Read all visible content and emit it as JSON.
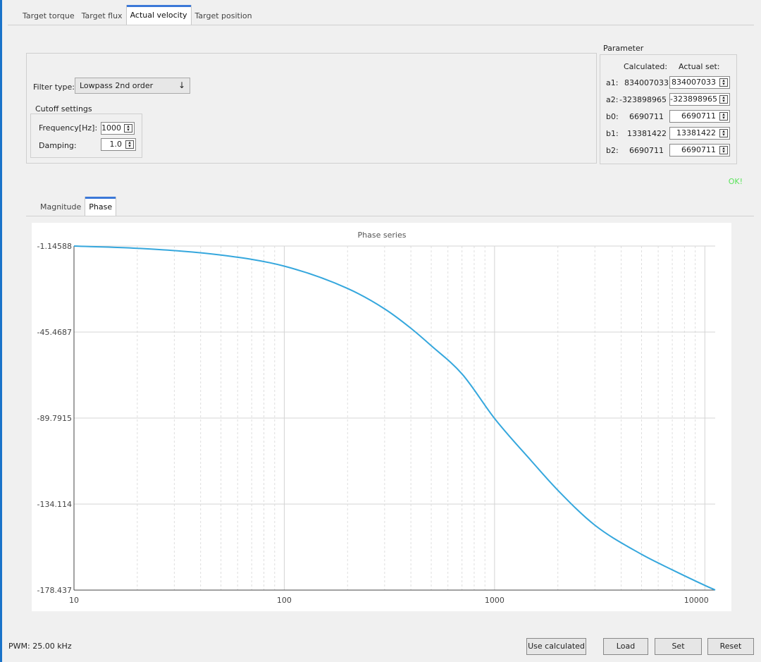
{
  "tabs": [
    "Target torque",
    "Target flux",
    "Actual velocity",
    "Target position"
  ],
  "active_tab": "Actual velocity",
  "filter": {
    "type_label": "Filter type:",
    "type_value": "Lowpass 2nd order",
    "cutoff_title": "Cutoff settings",
    "frequency_label": "Frequency[Hz]:",
    "frequency_value": "1000",
    "damping_label": "Damping:",
    "damping_value": "1.0"
  },
  "parameter": {
    "title": "Parameter",
    "calculated_header": "Calculated:",
    "actual_header": "Actual set:",
    "rows": [
      {
        "name": "a1:",
        "calculated": "834007033",
        "actual": "834007033"
      },
      {
        "name": "a2:",
        "calculated": "-323898965",
        "actual": "-323898965"
      },
      {
        "name": "b0:",
        "calculated": "6690711",
        "actual": "6690711"
      },
      {
        "name": "b1:",
        "calculated": "13381422",
        "actual": "13381422"
      },
      {
        "name": "b2:",
        "calculated": "6690711",
        "actual": "6690711"
      }
    ]
  },
  "status_ok": "OK!",
  "plot_tabs": [
    "Magnitude",
    "Phase"
  ],
  "active_plot_tab": "Phase",
  "chart_data": {
    "type": "line",
    "title": "Phase series",
    "x_scale": "log",
    "xlim": [
      10,
      11200
    ],
    "ylim": [
      -178.437,
      -1.14588
    ],
    "x_tick_labels": [
      "10",
      "100",
      "1000",
      "10000"
    ],
    "y_tick_labels": [
      "-1.14588",
      "-45.4687",
      "-89.7915",
      "-134.114",
      "-178.437"
    ],
    "grid": true,
    "line_color": "#35a7dd",
    "x": [
      10,
      20,
      50,
      100,
      200,
      300,
      400,
      500,
      700,
      1000,
      1500,
      2000,
      3000,
      5000,
      7000,
      10000,
      11200
    ],
    "y": [
      -1.15,
      -2.3,
      -5.8,
      -11.5,
      -23,
      -33.5,
      -43.5,
      -52.5,
      -67,
      -90,
      -112,
      -127,
      -145,
      -160,
      -168,
      -176,
      -178.4
    ]
  },
  "footer": {
    "pwm": "PWM: 25.00 kHz",
    "use_calculated": "Use calculated",
    "load": "Load",
    "set": "Set",
    "reset": "Reset"
  }
}
